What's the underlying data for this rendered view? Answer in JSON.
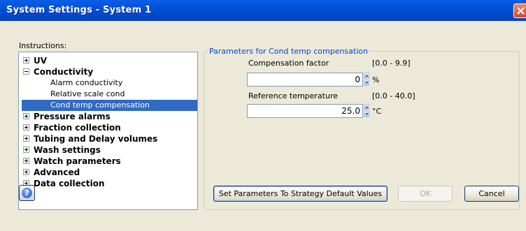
{
  "window": {
    "title": "System Settings - System 1"
  },
  "instructions_label": "Instructions:",
  "tree": [
    {
      "label": "UV",
      "expanded": false
    },
    {
      "label": "Conductivity",
      "expanded": true
    },
    {
      "label": "Alarm conductivity"
    },
    {
      "label": "Relative scale cond"
    },
    {
      "label": "Cond temp compensation",
      "selected": true
    },
    {
      "label": "Pressure alarms",
      "expanded": false
    },
    {
      "label": "Fraction collection",
      "expanded": false
    },
    {
      "label": "Tubing and Delay volumes",
      "expanded": false
    },
    {
      "label": "Wash settings",
      "expanded": false
    },
    {
      "label": "Watch parameters",
      "expanded": false
    },
    {
      "label": "Advanced",
      "expanded": false
    },
    {
      "label": "Data collection",
      "expanded": false
    }
  ],
  "params": {
    "group_title": "Parameters for Cond temp compensation",
    "fields": [
      {
        "label": "Compensation factor",
        "range": "[0.0 - 9.9]",
        "value": "0",
        "unit": "%"
      },
      {
        "label": "Reference temperature",
        "range": "[0.0 - 40.0]",
        "value": "25.0",
        "unit": "°C"
      }
    ]
  },
  "buttons": {
    "help": "?",
    "set_defaults": "Set Parameters To Strategy Default Values",
    "ok": "OK",
    "cancel": "Cancel"
  },
  "colors": {
    "title_bar": "#0050d8",
    "selection": "#316ac5",
    "group_title": "#0046d5",
    "dialog_bg": "#ece9d8"
  }
}
